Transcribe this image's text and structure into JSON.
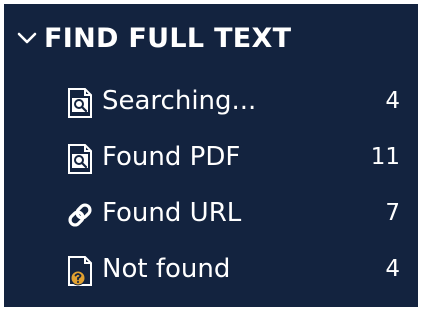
{
  "section": {
    "title": "FIND FULL TEXT",
    "expand_icon": "chevron-down-icon"
  },
  "items": [
    {
      "label": "Searching...",
      "count": "4",
      "icon": "search-document-icon"
    },
    {
      "label": "Found PDF",
      "count": "11",
      "icon": "search-document-icon"
    },
    {
      "label": "Found URL",
      "count": "7",
      "icon": "link-icon"
    },
    {
      "label": "Not found",
      "count": "4",
      "icon": "document-question-icon"
    }
  ],
  "colors": {
    "background": "#13233f",
    "text": "#ffffff",
    "icon_warning": "#e0a030"
  }
}
